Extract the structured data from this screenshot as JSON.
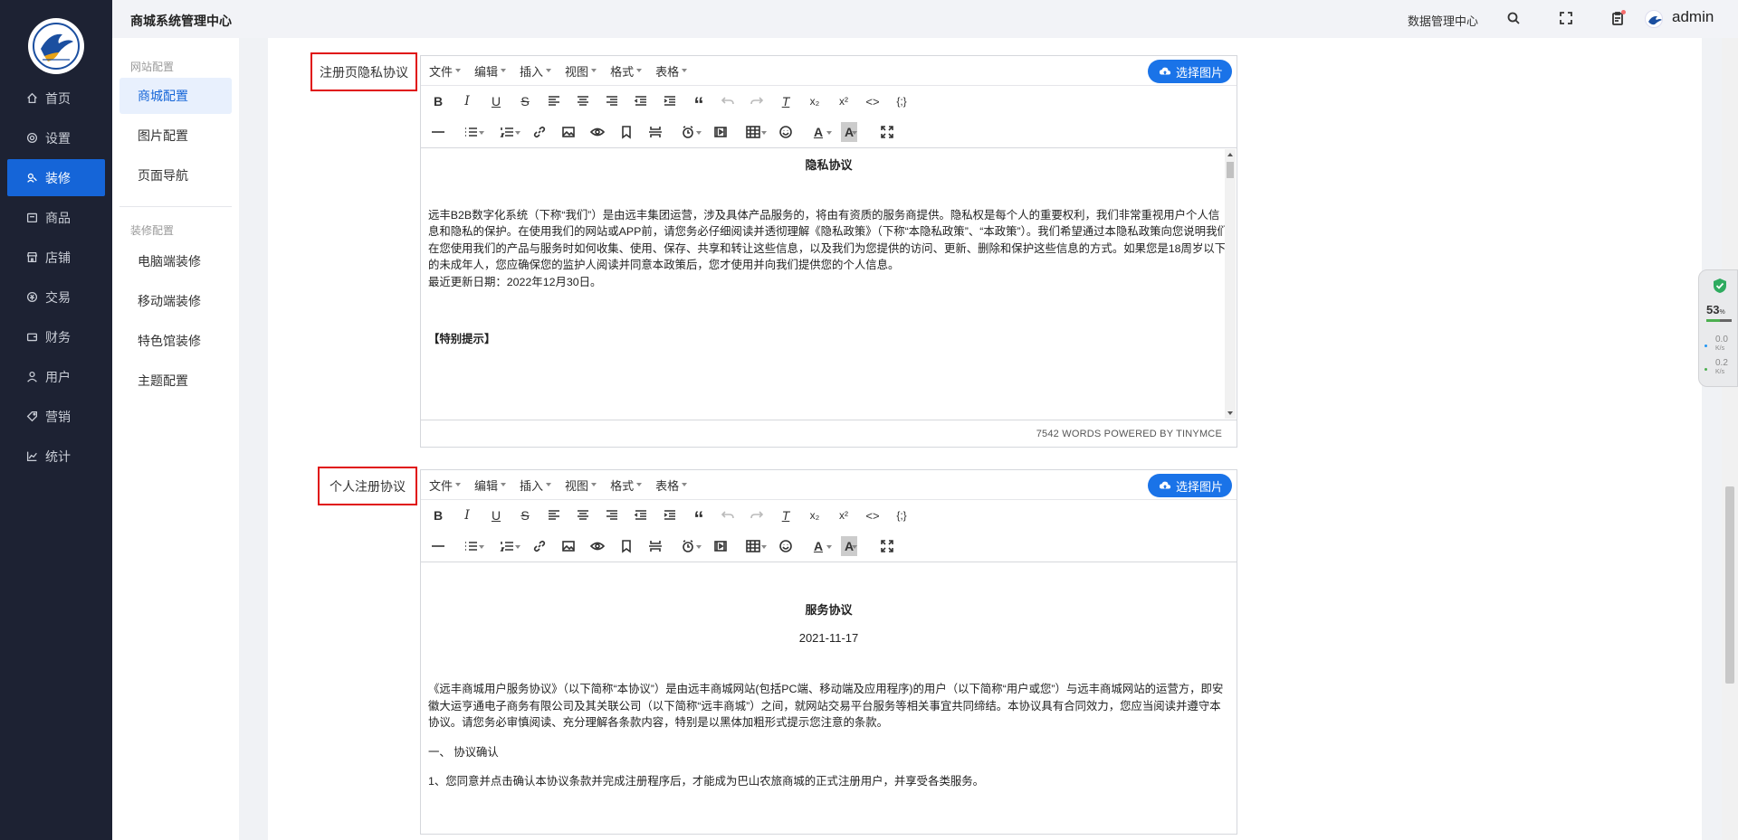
{
  "header": {
    "title": "商城系统管理中心",
    "data_center": "数据管理中心",
    "username": "admin",
    "icons": [
      "search-icon",
      "fullscreen-icon",
      "clipboard-icon"
    ]
  },
  "sidebar": {
    "items": [
      {
        "label": "首页",
        "icon": "home-icon"
      },
      {
        "label": "设置",
        "icon": "gear-icon"
      },
      {
        "label": "装修",
        "icon": "palette-icon",
        "active": true
      },
      {
        "label": "商品",
        "icon": "package-icon"
      },
      {
        "label": "店铺",
        "icon": "store-icon"
      },
      {
        "label": "交易",
        "icon": "exchange-icon"
      },
      {
        "label": "财务",
        "icon": "wallet-icon"
      },
      {
        "label": "用户",
        "icon": "user-icon"
      },
      {
        "label": "营销",
        "icon": "tag-icon"
      },
      {
        "label": "统计",
        "icon": "chart-icon"
      }
    ]
  },
  "submenu": {
    "group1": "网站配置",
    "group1_items": [
      "商城配置",
      "图片配置",
      "页面导航"
    ],
    "group2": "装修配置",
    "group2_items": [
      "电脑端装修",
      "移动端装修",
      "特色馆装修",
      "主题配置"
    ]
  },
  "editor_menus": [
    "文件",
    "编辑",
    "插入",
    "视图",
    "格式",
    "表格"
  ],
  "pic_button": "选择图片",
  "editor1": {
    "label": "注册页隐私协议",
    "title": "隐私协议",
    "para1": "远丰B2B数字化系统（下称“我们”）是由远丰集团运营，涉及具体产品服务的，将由有资质的服务商提供。隐私权是每个人的重要权利，我们非常重视用户个人信息和隐私的保护。在使用我们的网站或APP前，请您务必仔细阅读并透彻理解《隐私政策》（下称“本隐私政策”、“本政策”）。我们希望通过本隐私政策向您说明我们在您使用我们的产品与服务时如何收集、使用、保存、共享和转让这些信息，以及我们为您提供的访问、更新、删除和保护这些信息的方式。如果您是18周岁以下的未成年人，您应确保您的监护人阅读并同意本政策后，您才使用并向我们提供您的个人信息。",
    "para2": "最近更新日期：2022年12月30日。",
    "para3": "【特别提示】",
    "status": "7542 WORDS POWERED BY TINYMCE"
  },
  "editor2": {
    "label": "个人注册协议",
    "title": "服务协议",
    "date": "2021-11-17",
    "para1": "《远丰商城用户服务协议》（以下简称“本协议”）是由远丰商城网站(包括PC端、移动端及应用程序)的用户（以下简称“用户或您”）与远丰商城网站的运营方，即安徽大运亨通电子商务有限公司及其关联公司（以下简称“远丰商城”）之间，就网站交易平台服务等相关事宜共同缔结。本协议具有合同效力，您应当阅读并遵守本协议。请您务必审慎阅读、充分理解各条款内容，特别是以黑体加粗形式提示您注意的条款。",
    "para2": "一、 协议确认",
    "para3": "1、您同意并点击确认本协议条款并完成注册程序后，才能成为巴山农旅商城的正式注册用户，并享受各类服务。"
  },
  "widget": {
    "percent": "53",
    "percent_unit": "%",
    "cpu_fraction": 0.53,
    "up": "0.0",
    "up_unit": "K/s",
    "down": "0.2",
    "down_unit": "K/s"
  },
  "colors": {
    "sidebar_bg": "#1d2233",
    "accent": "#1565d8",
    "highlight_border": "#e01010"
  }
}
